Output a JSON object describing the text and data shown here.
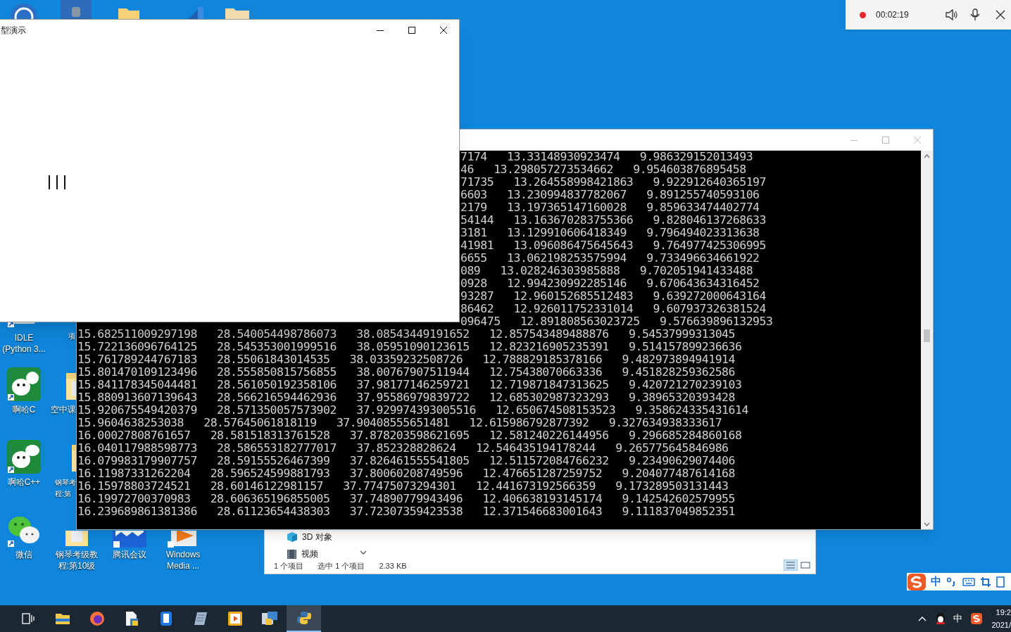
{
  "recorder": {
    "recording": true,
    "time": "00:02:19"
  },
  "desktop_icons": [
    {
      "kind": "python",
      "label_lines": [
        "IDLE",
        "(Python 3..."
      ]
    },
    {
      "kind": "none",
      "label_lines": [
        "项"
      ]
    },
    {
      "kind": "aha-c",
      "label_lines": [
        "啊哈C"
      ]
    },
    {
      "kind": "folder",
      "label_lines": [
        "空中课"
      ]
    },
    {
      "kind": "aha-cpp",
      "label_lines": [
        "啊哈C++"
      ]
    },
    {
      "kind": "folder",
      "label_lines": [
        "钢琴考",
        "程:第"
      ]
    },
    {
      "kind": "wechat",
      "label_lines": [
        "微信"
      ]
    },
    {
      "kind": "folder",
      "label_lines": [
        "钢琴考级教",
        "程:第10级"
      ]
    },
    {
      "kind": "meeting",
      "label_lines": [
        "腾讯会议"
      ]
    },
    {
      "kind": "media",
      "label_lines": [
        "Windows",
        "Media ..."
      ]
    }
  ],
  "explorer_window": {
    "nav_items": [
      {
        "kind": "cube",
        "label": "3D 对象"
      },
      {
        "kind": "video",
        "label": "视频"
      }
    ],
    "status": [
      "1 个项目",
      "选中 1 个项目",
      "2.33 KB"
    ]
  },
  "console_window": {
    "lines": [
      {
        "kind": "partial",
        "text": "7174   13.33148930923474   9.986329152013493"
      },
      {
        "kind": "partial",
        "text": "46   13.298057273534662   9.954603876895458"
      },
      {
        "kind": "partial",
        "text": "71735   13.264558998421863   9.922912640365197"
      },
      {
        "kind": "partial",
        "text": "6603   13.230994837782067   9.891255740593106"
      },
      {
        "kind": "partial",
        "text": "2179   13.197365147160028   9.859633474402774"
      },
      {
        "kind": "partial",
        "text": "54144   13.163670283755366   9.828046137268633"
      },
      {
        "kind": "partial",
        "text": "3181   13.129910606418349   9.796494023313638"
      },
      {
        "kind": "partial",
        "text": "41981   13.096086475645643   9.764977425306995"
      },
      {
        "kind": "partial",
        "text": "6655   13.062198253575994   9.733496634661922"
      },
      {
        "kind": "partial",
        "text": "089   13.028246303985888   9.702051941433488"
      },
      {
        "kind": "partial",
        "text": "0928   12.994230992285146   9.670643634316452"
      },
      {
        "kind": "partial",
        "text": "93287   12.960152685512483   9.639272000643164"
      },
      {
        "kind": "partial",
        "text": "86462   12.926011752331014   9.607937326381524"
      },
      {
        "kind": "partial",
        "text": "096475   12.891808563023725   9.576639896132953"
      },
      {
        "kind": "full",
        "text": "15.682511009297198   28.540054498786073   38.08543449191652   12.857543489488876   9.54537999313045"
      },
      {
        "kind": "full",
        "text": "15.722136096764125   28.545353001999516   38.05951090123615   12.823216905235391   9.514157899236636"
      },
      {
        "kind": "full",
        "text": "15.761789244767183   28.55061843014535   38.03359232508726   12.788829185378166   9.482973894941914"
      },
      {
        "kind": "full",
        "text": "15.801470109123496   28.555850815756855   38.00767907511944   12.75438070663336   9.451828259362586"
      },
      {
        "kind": "full",
        "text": "15.841178345044481   28.561050192358106   37.98177146259721   12.719871847313625   9.420721270239103"
      },
      {
        "kind": "full",
        "text": "15.880913607139643   28.566216594462936   37.95586979839722   12.685302987323293   9.38965320393428"
      },
      {
        "kind": "full",
        "text": "15.920675549420379   28.571350057573902   37.929974393005516   12.650674508153523   9.358624335431614"
      },
      {
        "kind": "full",
        "text": "15.9604638253038   28.57645061818119   37.90408555651481   12.615986792877392   9.327634938333617"
      },
      {
        "kind": "full",
        "text": "16.00027808761657   28.581518313761528   37.878203598621695   12.581240226144956   9.296685284860168"
      },
      {
        "kind": "full",
        "text": "16.040117988598773   28.586553182777017   37.852328828624   12.546435194178244   9.265775645846986"
      },
      {
        "kind": "full",
        "text": "16.079983179907757   28.59155526467399   37.826461555541805   12.511572084766232   9.23490629074406"
      },
      {
        "kind": "full",
        "text": "16.11987331262204   28.596524599881793   37.80060208749596   12.476651287259752   9.204077487614168"
      },
      {
        "kind": "full",
        "text": "16.15978803724521   28.60146122981157   37.77475073294301   12.441673192566359   9.173289503131443"
      },
      {
        "kind": "full",
        "text": "16.19972700370983   28.606365196855005   37.74890779943496   12.406638193145174   9.142542602579955"
      },
      {
        "kind": "full",
        "text": "16.239689861381386   28.61123654438303   37.72307359423538   12.371546683001643   9.111837049852351"
      }
    ]
  },
  "demo_window": {
    "title": "型演示"
  },
  "ime_bar": {
    "mode": "中"
  },
  "taskbar": {
    "apps": [
      {
        "kind": "taskview",
        "selected": false
      },
      {
        "kind": "explorer",
        "selected": false
      },
      {
        "kind": "firefox",
        "selected": false
      },
      {
        "kind": "document",
        "selected": false
      },
      {
        "kind": "phone",
        "selected": false
      },
      {
        "kind": "notepad",
        "selected": false
      },
      {
        "kind": "player",
        "selected": false
      },
      {
        "kind": "tool",
        "selected": false
      },
      {
        "kind": "python",
        "selected": true
      }
    ],
    "tray": {
      "ime": "中"
    },
    "clock": {
      "time": "19:2",
      "date": "2021/"
    }
  }
}
